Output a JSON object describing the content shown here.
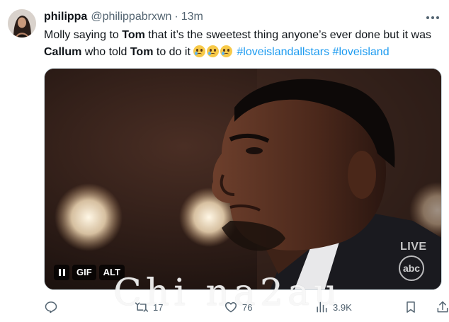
{
  "tweet": {
    "display_name": "philippa",
    "handle": "@philippabrxwn",
    "separator": "·",
    "time": "13m",
    "text": {
      "part1": "Molly saying to ",
      "bold1": "Tom",
      "part2": " that it’s the sweetest thing anyone’s ever done but it was ",
      "bold2": "Callum",
      "part3": " who told ",
      "bold3": "Tom",
      "part4": " to do it",
      "hashtag1": "#loveislandallstars",
      "hashtag2": "#loveisland"
    },
    "emojis": [
      "face-holding-back-tears",
      "face-holding-back-tears",
      "face-holding-back-tears"
    ]
  },
  "media": {
    "pause_icon": "pause-icon",
    "gif_label": "GIF",
    "alt_label": "ALT",
    "live_label": "LIVE",
    "network_logo": "abc"
  },
  "watermark": "Chi na2au",
  "actions": {
    "reply": {
      "icon": "reply-icon"
    },
    "repost": {
      "icon": "repost-icon",
      "count": "17"
    },
    "like": {
      "icon": "heart-icon",
      "count": "76"
    },
    "views": {
      "icon": "views-icon",
      "count": "3.9K"
    },
    "bookmark": {
      "icon": "bookmark-icon"
    }
  },
  "colors": {
    "text": "#0f1419",
    "secondary": "#536471",
    "link": "#1d9bf0",
    "border": "#cfd9de"
  }
}
